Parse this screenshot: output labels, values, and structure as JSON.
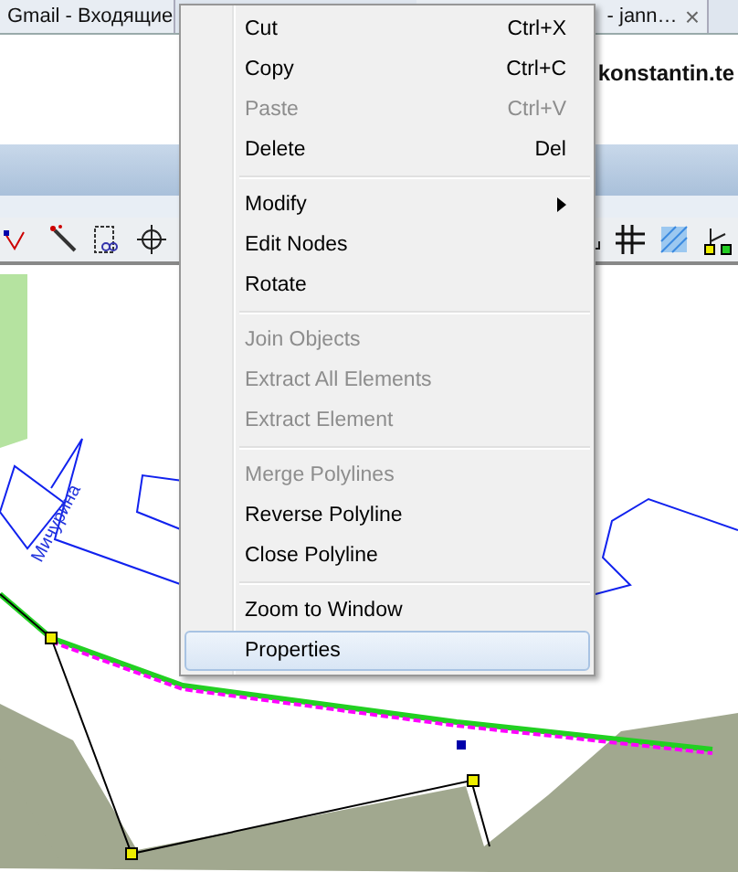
{
  "browser_tabs": [
    {
      "title": "Gmail - Входящие"
    },
    {
      "title": "- jann…",
      "close": "×"
    }
  ],
  "page": {
    "address": "konstantin.te"
  },
  "map": {
    "street_label": "Мичурина"
  },
  "context_menu": {
    "groups": [
      [
        {
          "label": "Cut",
          "shortcut": "Ctrl+X",
          "disabled": false,
          "submenu": false,
          "selected": false
        },
        {
          "label": "Copy",
          "shortcut": "Ctrl+C",
          "disabled": false,
          "submenu": false,
          "selected": false
        },
        {
          "label": "Paste",
          "shortcut": "Ctrl+V",
          "disabled": true,
          "submenu": false,
          "selected": false
        },
        {
          "label": "Delete",
          "shortcut": "Del",
          "disabled": false,
          "submenu": false,
          "selected": false
        }
      ],
      [
        {
          "label": "Modify",
          "disabled": false,
          "submenu": true,
          "selected": false
        },
        {
          "label": "Edit Nodes",
          "disabled": false,
          "submenu": false,
          "selected": false
        },
        {
          "label": "Rotate",
          "disabled": false,
          "submenu": false,
          "selected": false
        }
      ],
      [
        {
          "label": "Join Objects",
          "disabled": true,
          "submenu": false,
          "selected": false
        },
        {
          "label": "Extract All Elements",
          "disabled": true,
          "submenu": false,
          "selected": false
        },
        {
          "label": "Extract Element",
          "disabled": true,
          "submenu": false,
          "selected": false
        }
      ],
      [
        {
          "label": "Merge Polylines",
          "disabled": true,
          "submenu": false,
          "selected": false
        },
        {
          "label": "Reverse Polyline",
          "disabled": false,
          "submenu": false,
          "selected": false
        },
        {
          "label": "Close Polyline",
          "disabled": false,
          "submenu": false,
          "selected": false
        }
      ],
      [
        {
          "label": "Zoom to Window",
          "disabled": false,
          "submenu": false,
          "selected": false
        },
        {
          "label": "Properties",
          "disabled": false,
          "submenu": false,
          "selected": true
        }
      ]
    ]
  }
}
